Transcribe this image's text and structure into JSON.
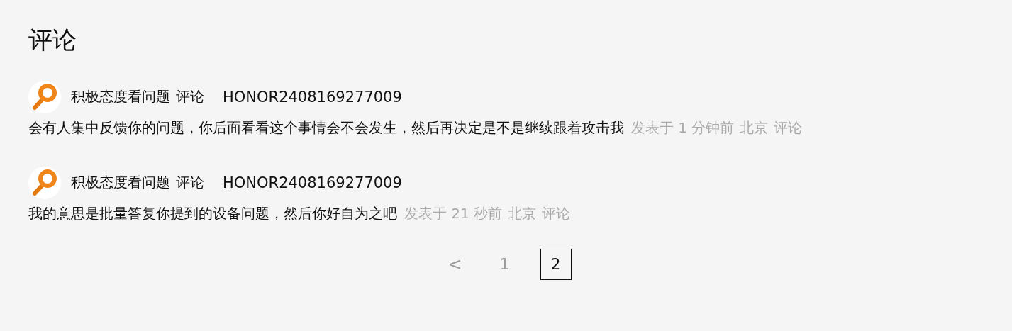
{
  "title": "评论",
  "comments": [
    {
      "user": "积极态度看问题",
      "action": "评论",
      "target": "HONOR2408169277009",
      "text": "会有人集中反馈你的问题，你后面看看这个事情会不会发生，然后再决定是不是继续跟着攻击我",
      "time": "发表于 1 分钟前",
      "location": "北京",
      "reply": "评论"
    },
    {
      "user": "积极态度看问题",
      "action": "评论",
      "target": "HONOR2408169277009",
      "text": "我的意思是批量答复你提到的设备问题，然后你好自为之吧",
      "time": "发表于 21 秒前",
      "location": "北京",
      "reply": "评论"
    }
  ],
  "pagination": {
    "prev": "<",
    "pages": [
      {
        "label": "1",
        "selected": false
      },
      {
        "label": "2",
        "selected": true
      }
    ]
  }
}
